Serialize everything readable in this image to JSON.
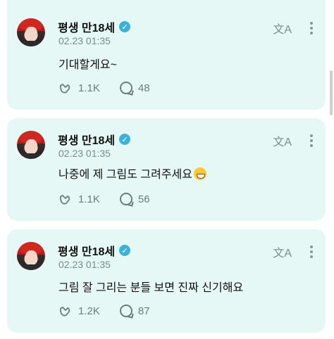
{
  "posts": [
    {
      "author": "평생 만18세",
      "timestamp": "02.23 01:35",
      "text": "기대할게요~",
      "has_emoji": false,
      "likes": "1.1K",
      "comments": "48"
    },
    {
      "author": "평생 만18세",
      "timestamp": "02.23 01:35",
      "text": "나중에 제 그림도 그려주세요",
      "has_emoji": true,
      "emoji": "grinning-face-with-teeth",
      "likes": "1.1K",
      "comments": "56"
    },
    {
      "author": "평생 만18세",
      "timestamp": "02.23 01:35",
      "text": "그림 잘 그리는 분들 보면 진짜 신기해요",
      "has_emoji": false,
      "likes": "1.2K",
      "comments": "87"
    }
  ],
  "icons": {
    "verified": "verified-badge-icon",
    "translate": "translate-icon",
    "more": "more-vertical-icon",
    "like": "clapping-hands-icon",
    "comment": "comment-bubble-icon"
  },
  "colors": {
    "card_bg": "#e6f8f5",
    "verified": "#3bb3d8",
    "muted": "#7a8a88"
  }
}
